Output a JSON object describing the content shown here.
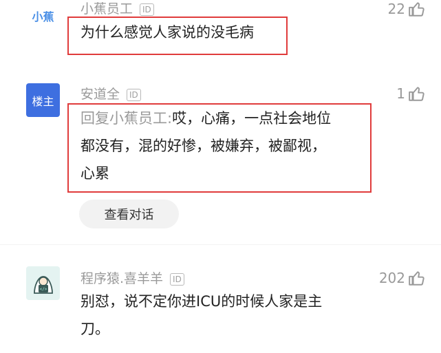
{
  "comments": [
    {
      "avatar_text": "小蕉",
      "username": "小蕉员工",
      "id_badge": "ID",
      "likes": "22",
      "text": "为什么感觉人家说的没毛病"
    },
    {
      "avatar_text": "楼主",
      "username": "安道全",
      "id_badge": "ID",
      "likes": "1",
      "reply_prefix": "回复小蕉员工:",
      "text_lines": [
        "哎，心痛，一点社会地位",
        "都没有，混的好惨，被嫌弃，被鄙视，",
        "心累"
      ],
      "view_conversation": "查看对话"
    },
    {
      "username": "程序猿.喜羊羊",
      "id_badge": "ID",
      "likes": "202",
      "text_lines": [
        "别怼，说不定你进ICU的时候人家是主",
        "刀。"
      ]
    }
  ],
  "colors": {
    "highlight_box": "#e03b3b",
    "host_badge": "#3e6fe0",
    "brand": "#4a8fe6"
  },
  "icons": {
    "like": "thumbs-up-icon",
    "coder_avatar": "coder-avatar-icon"
  }
}
